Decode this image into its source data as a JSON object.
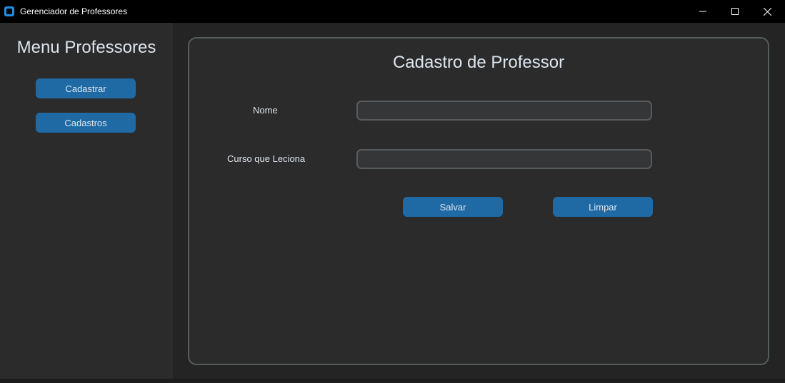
{
  "window": {
    "title": "Gerenciador de Professores",
    "icon": "app-icon",
    "controls": [
      "minimize-icon",
      "maximize-icon",
      "close-icon"
    ]
  },
  "sidebar": {
    "title": "Menu Professores",
    "buttons": [
      {
        "label": "Cadastrar"
      },
      {
        "label": "Cadastros"
      }
    ]
  },
  "form": {
    "title": "Cadastro de Professor",
    "fields": [
      {
        "label": "Nome",
        "value": "",
        "placeholder": ""
      },
      {
        "label": "Curso que Leciona",
        "value": "",
        "placeholder": ""
      }
    ],
    "save_label": "Salvar",
    "clear_label": "Limpar"
  },
  "colors": {
    "accent": "#1f6aa5",
    "window_bg": "#242424",
    "frame_bg": "#2b2b2b",
    "entry_bg": "#343638",
    "border": "#565b5e",
    "text": "#dce4ee",
    "titlebar": "#000000"
  }
}
